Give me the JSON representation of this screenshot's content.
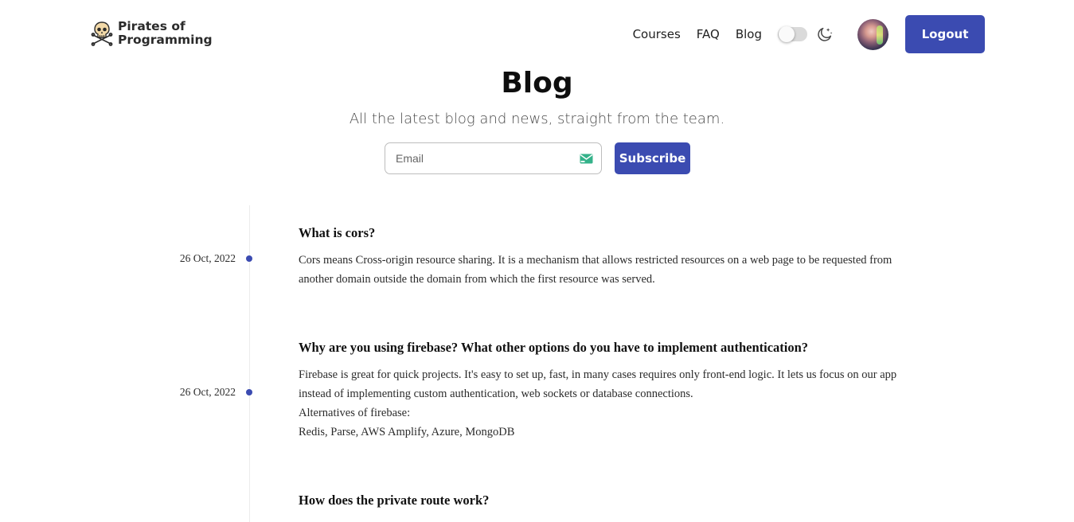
{
  "brand": {
    "line1": "Pirates of",
    "line2": "Programming",
    "logo_icon": "skull-crossbones-icon"
  },
  "nav": {
    "items": [
      {
        "label": "Courses"
      },
      {
        "label": "FAQ"
      },
      {
        "label": "Blog"
      }
    ],
    "theme_toggle_state": "off",
    "theme_icon": "moon-stars-icon",
    "logout_label": "Logout"
  },
  "hero": {
    "title": "Blog",
    "subtitle": "All the latest blog and news, straight from the team."
  },
  "subscribe": {
    "email_placeholder": "Email",
    "email_value": "",
    "button_label": "Subscribe",
    "mail_icon": "mail-icon"
  },
  "posts": [
    {
      "date": "26 Oct, 2022",
      "title": "What is cors?",
      "body": [
        "Cors means Cross-origin resource sharing. It is a mechanism that allows restricted resources on a web page to be requested from another domain outside the domain from which the first resource was served."
      ]
    },
    {
      "date": "26 Oct, 2022",
      "title": "Why are you using firebase? What other options do you have to implement authentication?",
      "body": [
        "Firebase is great for quick projects. It's easy to set up, fast, in many cases requires only front-end logic. It lets us focus on our app instead of implementing custom authentication, web sockets or database connections.",
        "Alternatives of firebase:",
        "Redis, Parse, AWS Amplify, Azure, MongoDB"
      ]
    },
    {
      "date": "",
      "title": "How does the private route work?",
      "body": []
    }
  ],
  "colors": {
    "accent": "#3b4bb1",
    "text": "#1f1f1f",
    "timeline": "#ececec"
  }
}
